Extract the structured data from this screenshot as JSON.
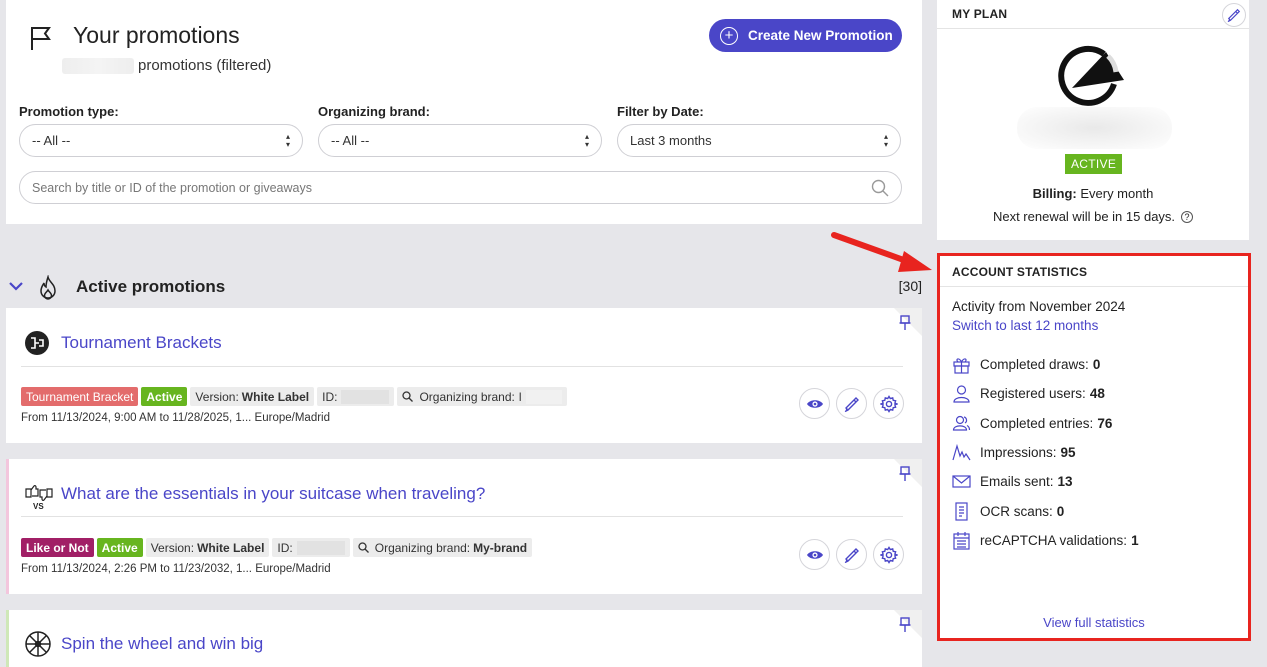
{
  "header": {
    "title": "Your promotions",
    "subtitle": "promotions (filtered)",
    "create_button": "Create New Promotion"
  },
  "filters": {
    "promotion_type": {
      "label": "Promotion type:",
      "value": "-- All --"
    },
    "organizing_brand": {
      "label": "Organizing brand:",
      "value": "-- All --"
    },
    "date": {
      "label": "Filter by Date:",
      "value": "Last 3 months"
    },
    "search_placeholder": "Search by title or ID of the promotion or giveaways"
  },
  "section": {
    "title": "Active promotions",
    "count": "[30]"
  },
  "promotions": [
    {
      "title": "Tournament Brackets",
      "type_tag": "Tournament Bracket",
      "status": "Active",
      "version_label": "Version:",
      "version_value": "White Label",
      "id_label": "ID:",
      "brand_label": "Organizing brand:",
      "brand_value": "l",
      "dates": "From 11/13/2024, 9:00 AM to 11/28/2025, 1... Europe/Madrid"
    },
    {
      "title": "What are the essentials in your suitcase when traveling?",
      "type_tag": "Like or Not",
      "status": "Active",
      "version_label": "Version:",
      "version_value": "White Label",
      "id_label": "ID:",
      "brand_label": "Organizing brand:",
      "brand_value": "My-brand",
      "dates": "From 11/13/2024, 2:26 PM to 11/23/2032, 1... Europe/Madrid"
    },
    {
      "title": "Spin the wheel and win big"
    }
  ],
  "plan": {
    "label": "MY PLAN",
    "status": "ACTIVE",
    "billing_label": "Billing:",
    "billing_value": "Every month",
    "renewal": "Next renewal will be in 15 days."
  },
  "stats": {
    "label": "ACCOUNT STATISTICS",
    "activity": "Activity from November 2024",
    "switch_link": "Switch to last 12 months",
    "rows": [
      {
        "label": "Completed draws:",
        "value": "0",
        "icon": "gift-icon"
      },
      {
        "label": "Registered users:",
        "value": "48",
        "icon": "user-icon"
      },
      {
        "label": "Completed entries:",
        "value": "76",
        "icon": "users-icon"
      },
      {
        "label": "Impressions:",
        "value": "95",
        "icon": "graph-icon"
      },
      {
        "label": "Emails sent:",
        "value": "13",
        "icon": "mail-icon"
      },
      {
        "label": "OCR scans:",
        "value": "0",
        "icon": "receipt-icon"
      },
      {
        "label": "reCAPTCHA validations:",
        "value": "1",
        "icon": "calendar-icon"
      }
    ],
    "view_full": "View full statistics"
  },
  "colors": {
    "accent": "#4a46c8",
    "active_green": "#67b51f",
    "highlight_red": "#e8241f",
    "tournament_tag": "#e36c6c",
    "like_or_not_tag": "#a11f66"
  }
}
